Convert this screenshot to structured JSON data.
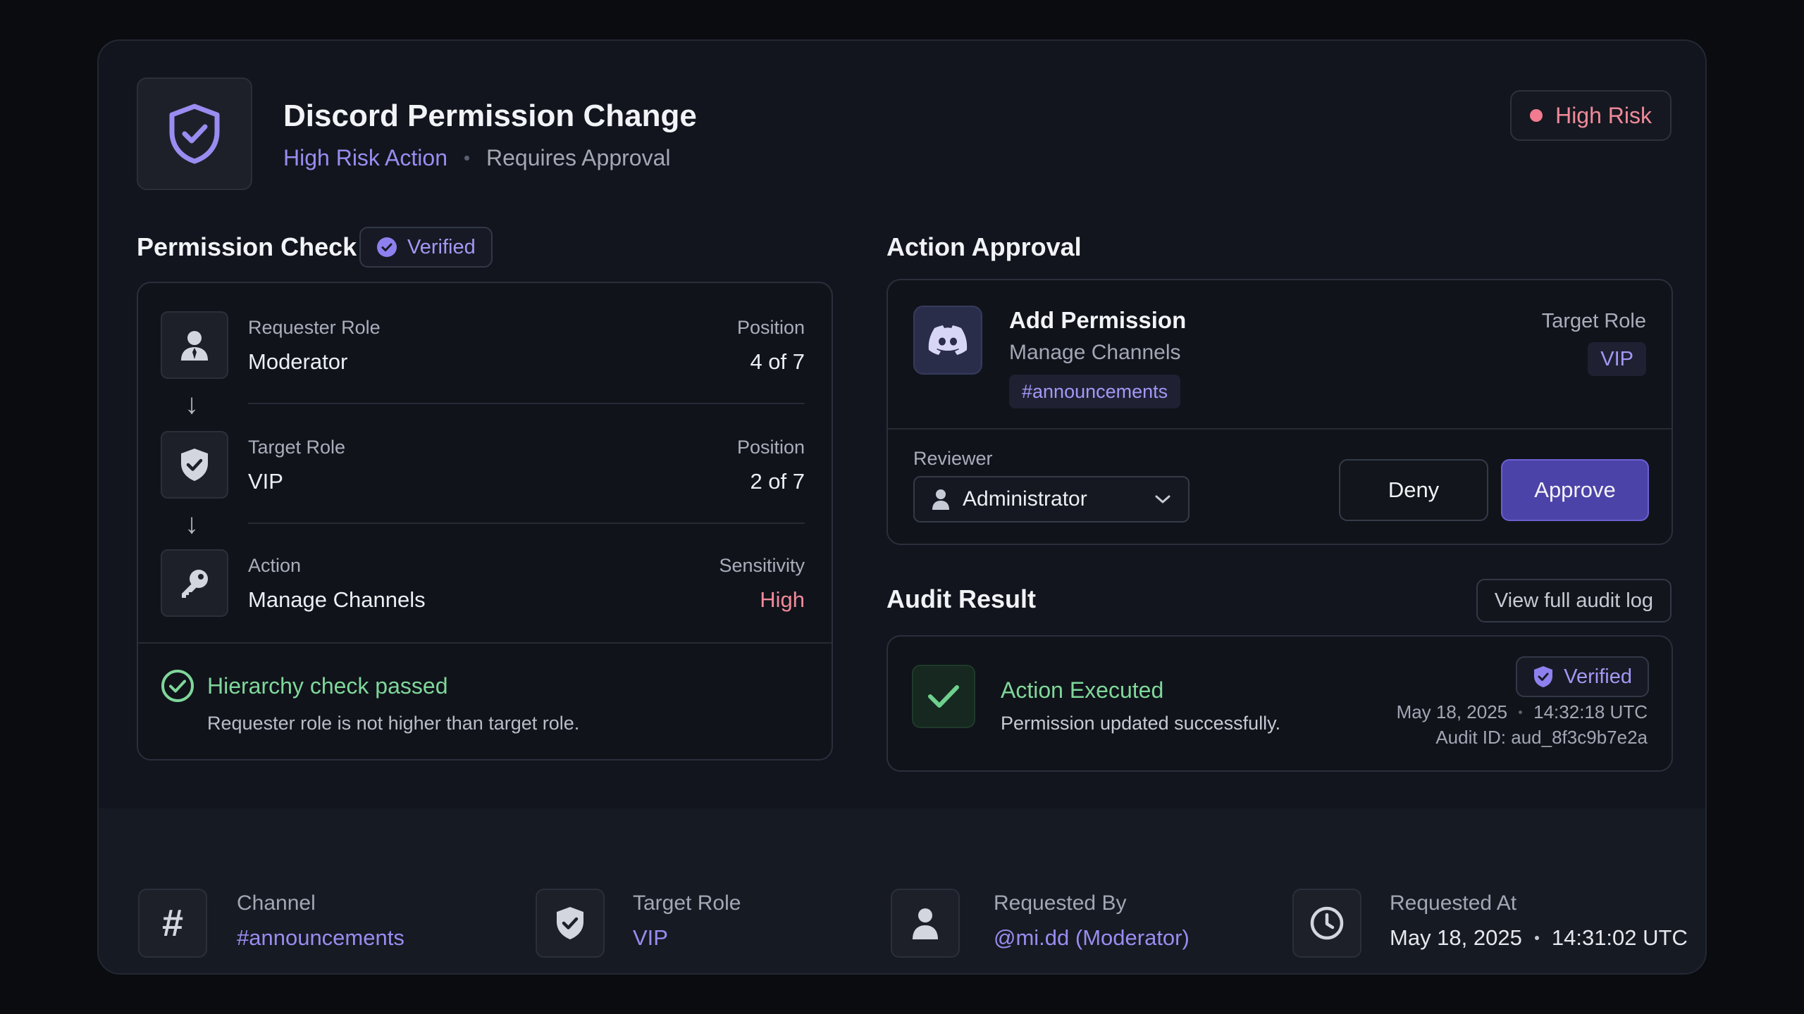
{
  "header": {
    "title": "Discord Permission Change",
    "subtitle_risk": "High Risk Action",
    "subtitle_status": "Requires Approval",
    "risk_badge": "High Risk"
  },
  "permission_check": {
    "title": "Permission Check",
    "badge": "Verified",
    "rows": [
      {
        "label": "Requester Role",
        "value": "Moderator",
        "meta_label": "Position",
        "meta_value": "4 of 7",
        "icon": "user-icon"
      },
      {
        "label": "Target Role",
        "value": "VIP",
        "meta_label": "Position",
        "meta_value": "2 of 7",
        "icon": "shield-check-icon"
      },
      {
        "label": "Action",
        "value": "Manage Channels",
        "meta_label": "Sensitivity",
        "meta_value": "High",
        "icon": "key-icon"
      }
    ],
    "result_title": "Hierarchy check passed",
    "result_desc": "Requester role is not higher than target role."
  },
  "action_approval": {
    "title": "Action Approval",
    "action_title": "Add Permission",
    "action_perm": "Manage Channels",
    "channel_tag": "#announcements",
    "target_label": "Target Role",
    "target_value": "VIP",
    "reviewer_label": "Reviewer",
    "reviewer_value": "Administrator",
    "deny_label": "Deny",
    "approve_label": "Approve"
  },
  "audit": {
    "title": "Audit Result",
    "view_log": "View full audit log",
    "result_title": "Action Executed",
    "result_desc": "Permission updated successfully.",
    "badge": "Verified",
    "date": "May 18, 2025",
    "time": "14:32:18 UTC",
    "audit_id": "Audit ID: aud_8f3c9b7e2a"
  },
  "footer": {
    "channel_label": "Channel",
    "channel_value": "#announcements",
    "target_label": "Target Role",
    "target_value": "VIP",
    "requested_by_label": "Requested By",
    "requested_by_value": "@mi.dd (Moderator)",
    "requested_at_label": "Requested At",
    "requested_at_date": "May 18, 2025",
    "requested_at_time": "14:31:02 UTC"
  },
  "colors": {
    "accent": "#9a8cf0",
    "danger": "#f27b90",
    "success": "#7fd79a",
    "approve": "#4c43a8"
  }
}
